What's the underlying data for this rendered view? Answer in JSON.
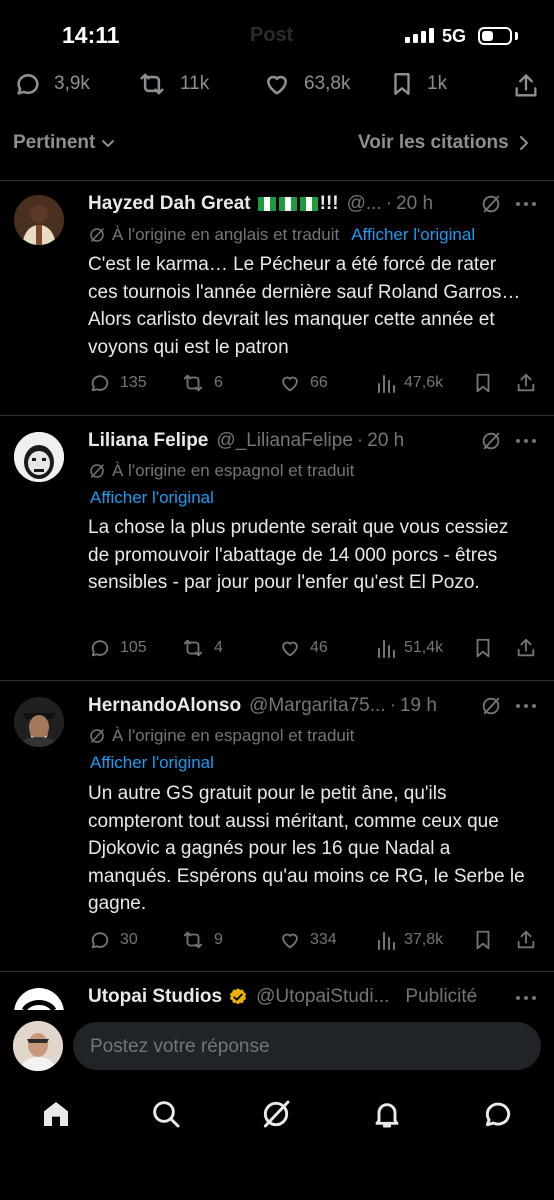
{
  "status_bar": {
    "time": "14:11",
    "title": "Post",
    "network": "5G"
  },
  "stats": {
    "replies": "3,9k",
    "reposts": "11k",
    "likes": "63,8k",
    "bookmarks": "1k"
  },
  "sort": {
    "label": "Pertinent",
    "quotes": "Voir les citations"
  },
  "replies": [
    {
      "name": "Hayzed Dah Great",
      "name_suffix": "!!!",
      "handle": "@...",
      "time": "20 h",
      "translation_note": "À l'origine en anglais et traduit",
      "show_original": "Afficher l'original",
      "text": "C'est le karma… Le Pécheur a été forcé de rater ces tournois l'année dernière sauf Roland Garros… Alors carlisto devrait les manquer cette année et voyons qui est le patron",
      "replies": "135",
      "reposts": "6",
      "likes": "66",
      "views": "47,6k"
    },
    {
      "name": "Liliana Felipe",
      "handle": "@_LilianaFelipe",
      "time": "20 h",
      "translation_note": "À l'origine en espagnol et traduit",
      "show_original": "Afficher l'original",
      "text": "La chose la plus prudente serait que vous cessiez de promouvoir l'abattage de 14 000 porcs - êtres sensibles - par jour pour l'enfer qu'est El Pozo.",
      "replies": "105",
      "reposts": "4",
      "likes": "46",
      "views": "51,4k"
    },
    {
      "name": "HernandoAlonso",
      "handle": "@Margarita75...",
      "time": "19 h",
      "translation_note": "À l'origine en espagnol et traduit",
      "show_original": "Afficher l'original",
      "text": "Un autre GS gratuit pour le petit âne, qu'ils compteront tout aussi méritant, comme ceux que Djokovic a gagnés pour les 16 que Nadal a manqués. Espérons qu'au moins ce RG, le Serbe le gagne.",
      "replies": "30",
      "reposts": "9",
      "likes": "334",
      "views": "37,8k"
    },
    {
      "name": "Utopai Studios",
      "handle": "@UtopaiStudi...",
      "ad_label": "Publicité"
    }
  ],
  "composer": {
    "placeholder": "Postez votre réponse"
  },
  "nav": [
    "home",
    "search",
    "grok",
    "notifications",
    "messages"
  ],
  "colors": {
    "background": "#000000",
    "text": "#e7e9ea",
    "muted": "#71767b",
    "link": "#1d9bf0",
    "divider": "#2f3336",
    "verified": "#e8b100"
  }
}
